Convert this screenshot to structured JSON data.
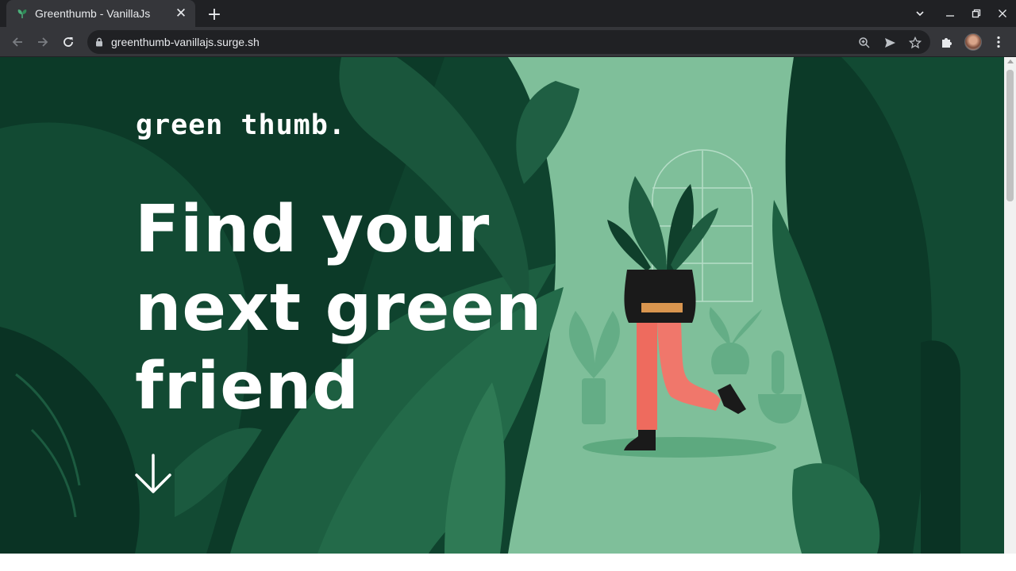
{
  "browser": {
    "tab": {
      "title": "Greenthumb - VanillaJs",
      "favicon": "plant-favicon"
    },
    "new_tab_label": "+",
    "url": "greenthumb-vanillajs.surge.sh"
  },
  "page": {
    "brand": "green thumb.",
    "headline": [
      "Find your",
      "next green",
      "friend"
    ],
    "colors": {
      "background_dark": "#0e3f2c",
      "leaf_dark": "#0a3324",
      "leaf_mid": "#1b5a3f",
      "leaf_light": "#2d7654",
      "pathway": "#7fbf9a",
      "text": "#ffffff",
      "pants": "#ee6b5e"
    },
    "icons": [
      "arrow-down-icon"
    ]
  }
}
